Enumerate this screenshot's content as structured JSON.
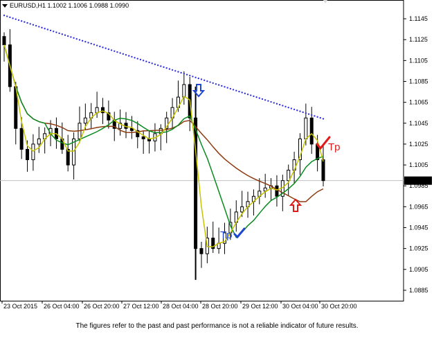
{
  "window": {
    "title": "EURUSD,H1  1.1002 1.1006 1.0988 1.0990",
    "menu_icon": "triangle-down-icon",
    "close_icon": "close-icon"
  },
  "price_axis": {
    "ticks": [
      "1.1145",
      "1.1125",
      "1.1105",
      "1.1085",
      "1.1065",
      "1.1045",
      "1.1025",
      "1.1005",
      "1.0985",
      "1.0965",
      "1.0945",
      "1.0925",
      "1.0905",
      "1.0885"
    ],
    "current_price": "1.0990"
  },
  "time_axis": {
    "ticks": [
      "23 Oct 2015",
      "26 Oct 04:00",
      "26 Oct 20:00",
      "27 Oct 12:00",
      "28 Oct 04:00",
      "28 Oct 20:00",
      "29 Oct 12:00",
      "30 Oct 04:00",
      "30 Oct 20:00"
    ]
  },
  "annotations": {
    "tp_left": "Tp",
    "tp_right": "Tp",
    "down_arrow_icon": "arrow-down-icon",
    "up_arrow_icon": "arrow-up-icon",
    "check_icon": "checkmark-icon"
  },
  "colors": {
    "sar": "#3333dd",
    "ma_brown": "#8b3a0f",
    "ma_green": "#0a8a1e",
    "ma_olive": "#c8c400",
    "candles": "#000000",
    "signal_blue": "#1e46d2",
    "signal_red": "#e01b1b"
  },
  "chart_data": {
    "type": "candlestick",
    "symbol": "EURUSD",
    "timeframe": "H1",
    "ylim": [
      1.0875,
      1.1155
    ],
    "close_series": [
      1.112,
      1.108,
      1.104,
      1.102,
      1.101,
      1.1025,
      1.103,
      1.1035,
      1.104,
      1.103,
      1.102,
      1.1005,
      1.103,
      1.1045,
      1.105,
      1.1055,
      1.106,
      1.1055,
      1.1048,
      1.104,
      1.1045,
      1.104,
      1.1038,
      1.1032,
      1.103,
      1.1028,
      1.1035,
      1.104,
      1.105,
      1.106,
      1.107,
      1.1082,
      1.105,
      1.0925,
      1.092,
      1.0935,
      1.0925,
      1.093,
      1.094,
      1.095,
      1.096,
      1.0965,
      1.097,
      1.0975,
      1.098,
      1.0983,
      1.0985,
      1.0975,
      1.099,
      1.1,
      1.101,
      1.103,
      1.105,
      1.1025,
      1.101,
      1.099
    ]
  },
  "footer": {
    "disclaimer": "The figures refer to the past and past performance is not a reliable indicator of future results."
  }
}
